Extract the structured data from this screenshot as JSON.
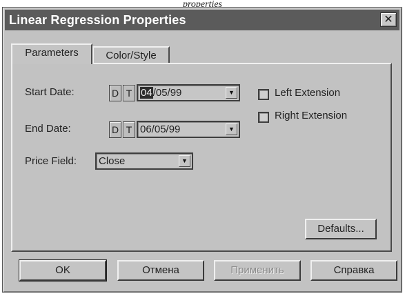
{
  "page_caption": "properties",
  "window": {
    "title": "Linear Regression Properties",
    "close_glyph": "✕"
  },
  "tabs": [
    {
      "label": "Parameters",
      "active": true
    },
    {
      "label": "Color/Style",
      "active": false
    }
  ],
  "parameters": {
    "start_date": {
      "label": "Start Date:",
      "d_label": "D",
      "t_label": "T",
      "value_selected": "04",
      "value_rest": "/05/99"
    },
    "end_date": {
      "label": "End Date:",
      "d_label": "D",
      "t_label": "T",
      "value": "06/05/99"
    },
    "price_field": {
      "label": "Price Field:",
      "value": "Close"
    },
    "left_extension": {
      "label": "Left Extension",
      "checked": false
    },
    "right_extension": {
      "label": "Right Extension",
      "checked": false
    },
    "defaults_button": "Defaults..."
  },
  "footer": {
    "ok": "OK",
    "cancel": "Отмена",
    "apply": "Применить",
    "help": "Справка"
  },
  "icons": {
    "dropdown_arrow": "▼"
  }
}
